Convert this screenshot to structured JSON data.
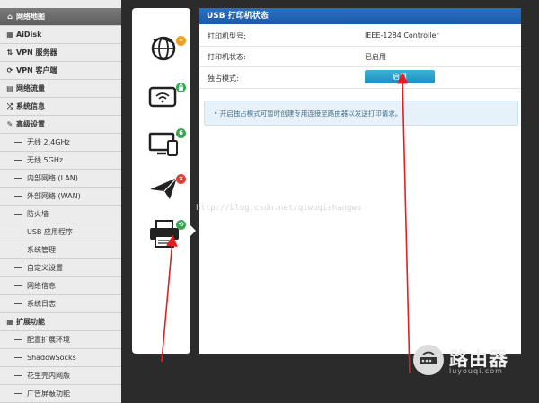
{
  "sidebar": {
    "items": [
      {
        "label": "网络地图",
        "icon": "home-icon",
        "glyph": "⌂",
        "level": "top",
        "active": true
      },
      {
        "label": "AiDisk",
        "icon": "disk-icon",
        "glyph": "▦",
        "level": "top"
      },
      {
        "label": "VPN 服务器",
        "icon": "vpn-server-icon",
        "glyph": "⇅",
        "level": "top"
      },
      {
        "label": "VPN 客户端",
        "icon": "vpn-client-icon",
        "glyph": "⟳",
        "level": "top"
      },
      {
        "label": "网络流量",
        "icon": "traffic-icon",
        "glyph": "▤",
        "level": "top"
      },
      {
        "label": "系统信息",
        "icon": "shuffle-icon",
        "glyph": "⤮",
        "level": "top"
      },
      {
        "label": "高级设置",
        "icon": "wrench-icon",
        "glyph": "✎",
        "level": "top"
      },
      {
        "label": "无线 2.4GHz",
        "level": "sub"
      },
      {
        "label": "无线 5GHz",
        "level": "sub"
      },
      {
        "label": "内部网络 (LAN)",
        "level": "sub"
      },
      {
        "label": "外部网络 (WAN)",
        "level": "sub"
      },
      {
        "label": "防火墙",
        "level": "sub"
      },
      {
        "label": "USB 应用程序",
        "level": "sub"
      },
      {
        "label": "系统管理",
        "level": "sub"
      },
      {
        "label": "自定义设置",
        "level": "sub"
      },
      {
        "label": "网络信息",
        "level": "sub"
      },
      {
        "label": "系统日志",
        "level": "sub"
      },
      {
        "label": "扩展功能",
        "icon": "grid-icon",
        "glyph": "▦",
        "level": "top"
      },
      {
        "label": "配置扩展环境",
        "level": "sub"
      },
      {
        "label": "ShadowSocks",
        "level": "sub"
      },
      {
        "label": "花生壳内网版",
        "level": "sub"
      },
      {
        "label": "广告屏蔽功能",
        "level": "sub"
      }
    ]
  },
  "status_icons": [
    {
      "name": "internet-globe-icon",
      "badge": "−",
      "badge_color": "#f0a020"
    },
    {
      "name": "wireless-tablet-icon",
      "badge": "🔒",
      "badge_color": "#3aa655"
    },
    {
      "name": "clients-monitor-icon",
      "badge": "6",
      "badge_color": "#3aa655"
    },
    {
      "name": "usb-send-icon",
      "badge": "×",
      "badge_color": "#d9443a"
    },
    {
      "name": "printer-icon",
      "badge": "⟲",
      "badge_color": "#3aa655"
    }
  ],
  "panel": {
    "title": "USB 打印机状态",
    "model_label": "打印机型号:",
    "model_value": "IEEE-1284 Controller",
    "status_label": "打印机状态:",
    "status_value": "已启用",
    "exclusive_label": "独占模式:",
    "exclusive_button": "启用",
    "info_text": "•  开启独占模式可暂时创建专用连接至路由器以发送打印请求。"
  },
  "watermark": "http://blog.csdn.net/qiwuqishangwu",
  "logo": {
    "text": "路由器",
    "subtext": "luyouqi.com"
  },
  "colors": {
    "header_blue": "#1f63b3",
    "button_teal": "#27a0cc",
    "arrow_red": "#e02020",
    "dark_bg": "#2b2b2b"
  }
}
